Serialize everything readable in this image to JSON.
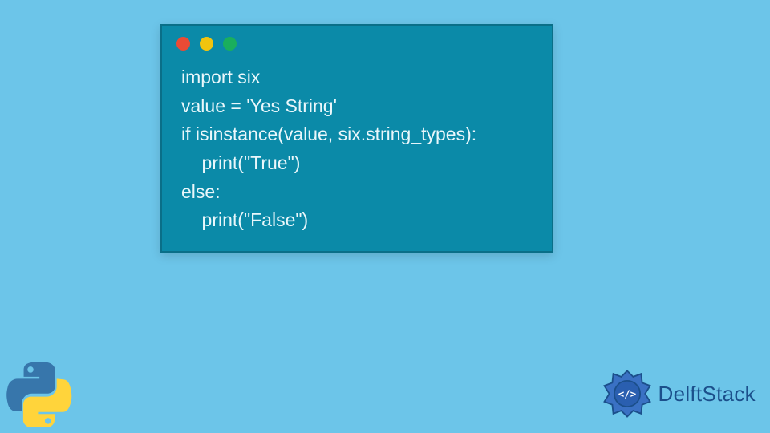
{
  "code_window": {
    "dots": [
      "red",
      "yellow",
      "green"
    ],
    "lines": [
      "import six",
      "value = 'Yes String'",
      "if isinstance(value, six.string_types):",
      "    print(\"True\")",
      "else:",
      "    print(\"False\")"
    ]
  },
  "brand": {
    "name": "DelftStack"
  },
  "colors": {
    "page_bg": "#6cc5e9",
    "window_bg": "#0b8aa8",
    "window_border": "#0a6f88",
    "code_text": "#eaf7fb",
    "brand_text": "#1b4f8b",
    "brand_icon": "#2a5fb0",
    "python_blue": "#3776ab",
    "python_yellow": "#ffd43b"
  }
}
